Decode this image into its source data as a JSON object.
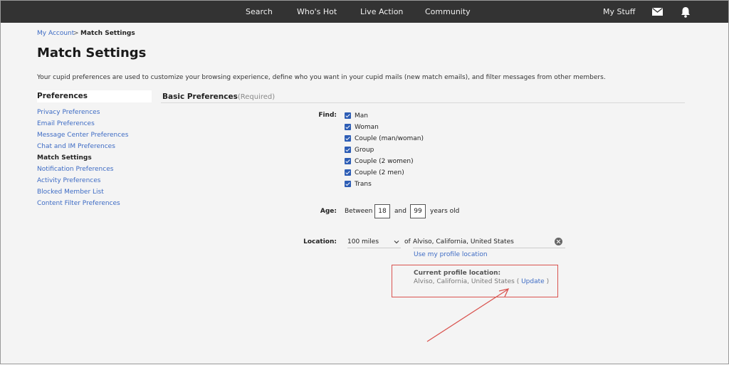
{
  "nav": {
    "items": [
      "Search",
      "Who's Hot",
      "Live Action",
      "Community"
    ],
    "my_stuff": "My Stuff",
    "mail_icon": "mail-icon",
    "bell_icon": "bell-icon"
  },
  "breadcrumb": {
    "parent": "My Account",
    "separator": ">",
    "current": "Match Settings"
  },
  "page": {
    "title": "Match Settings",
    "intro": "Your cupid preferences are used to customize your browsing experience, define who you want in your cupid mails (new match emails), and filter messages from other members."
  },
  "sidebar": {
    "heading": "Preferences",
    "items": [
      {
        "label": "Privacy Preferences",
        "active": false
      },
      {
        "label": "Email Preferences",
        "active": false
      },
      {
        "label": "Message Center Preferences",
        "active": false
      },
      {
        "label": "Chat and IM Preferences",
        "active": false
      },
      {
        "label": "Match Settings",
        "active": true
      },
      {
        "label": "Notification Preferences",
        "active": false
      },
      {
        "label": "Activity Preferences",
        "active": false
      },
      {
        "label": "Blocked Member List",
        "active": false
      },
      {
        "label": "Content Filter Preferences",
        "active": false
      }
    ]
  },
  "section": {
    "title": "Basic Preferences",
    "required": "(Required)"
  },
  "find": {
    "label": "Find:",
    "options": [
      {
        "label": "Man",
        "checked": true
      },
      {
        "label": "Woman",
        "checked": true
      },
      {
        "label": "Couple (man/woman)",
        "checked": true
      },
      {
        "label": "Group",
        "checked": true
      },
      {
        "label": "Couple (2 women)",
        "checked": true
      },
      {
        "label": "Couple (2 men)",
        "checked": true
      },
      {
        "label": "Trans",
        "checked": true
      }
    ]
  },
  "age": {
    "label": "Age:",
    "between": "Between",
    "min": "18",
    "and": "and",
    "max": "99",
    "suffix": "years old"
  },
  "location": {
    "label": "Location:",
    "distance": "100 miles",
    "of": "of",
    "value": "Alviso, California, United States",
    "use_profile": "Use my profile location",
    "current_heading": "Current profile location:",
    "current_value": "Alviso, California, United States",
    "paren_open": "(",
    "update": "Update",
    "paren_close": ")"
  },
  "colors": {
    "topbar": "#333333",
    "link": "#3d6bc4",
    "checkbox": "#2d5db5",
    "callout": "#d9534f"
  }
}
